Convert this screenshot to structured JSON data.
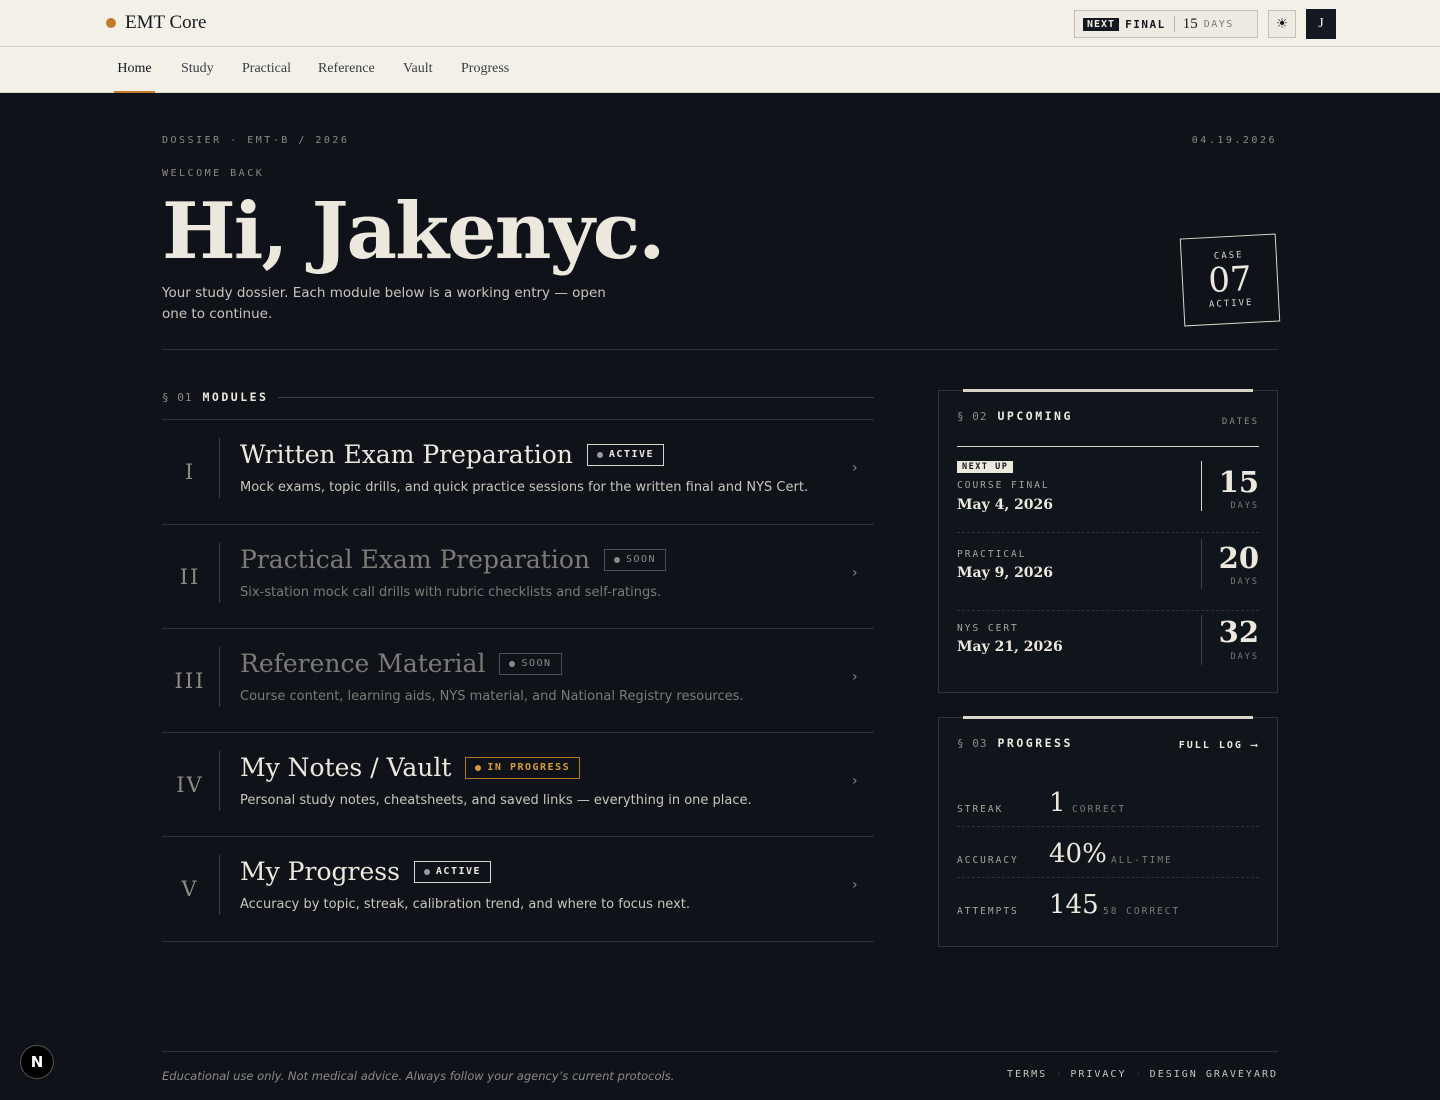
{
  "app": {
    "name": "EMT Core"
  },
  "countdown": {
    "tag": "NEXT",
    "label": "FINAL",
    "value": "15",
    "unit": "DAYS"
  },
  "user": {
    "initial": "J"
  },
  "nav": [
    "Home",
    "Study",
    "Practical",
    "Reference",
    "Vault",
    "Progress"
  ],
  "header": {
    "dossier": "DOSSIER · EMT-B / 2026",
    "date": "04.19.2026",
    "welcome": "WELCOME BACK",
    "greeting": "Hi, Jakenyc.",
    "intro": "Your study dossier. Each module below is a working entry — open one to continue.",
    "case": {
      "label": "CASE",
      "number": "07",
      "status": "ACTIVE"
    }
  },
  "modules_section": {
    "num": "§ 01",
    "title": "MODULES"
  },
  "modules": [
    {
      "roman": "I",
      "title": "Written Exam Preparation",
      "badge": "ACTIVE",
      "desc": "Mock exams, topic drills, and quick practice sessions for the written final and NYS Cert."
    },
    {
      "roman": "II",
      "title": "Practical Exam Preparation",
      "badge": "SOON",
      "desc": "Six-station mock call drills with rubric checklists and self-ratings."
    },
    {
      "roman": "III",
      "title": "Reference Material",
      "badge": "SOON",
      "desc": "Course content, learning aids, NYS material, and National Registry resources."
    },
    {
      "roman": "IV",
      "title": "My Notes / Vault",
      "badge": "IN PROGRESS",
      "desc": "Personal study notes, cheatsheets, and saved links — everything in one place."
    },
    {
      "roman": "V",
      "title": "My Progress",
      "badge": "ACTIVE",
      "desc": "Accuracy by topic, streak, calibration trend, and where to focus next."
    }
  ],
  "upcoming": {
    "num": "§ 02",
    "title": "UPCOMING",
    "right": "DATES",
    "next_up": "NEXT UP",
    "items": [
      {
        "label": "COURSE FINAL",
        "date": "May 4, 2026",
        "days": "15",
        "unit": "DAYS"
      },
      {
        "label": "PRACTICAL",
        "date": "May 9, 2026",
        "days": "20",
        "unit": "DAYS"
      },
      {
        "label": "NYS CERT",
        "date": "May 21, 2026",
        "days": "32",
        "unit": "DAYS"
      }
    ]
  },
  "progress": {
    "num": "§ 03",
    "title": "PROGRESS",
    "link": "FULL LOG",
    "stats": [
      {
        "label": "STREAK",
        "value": "1",
        "sub": "CORRECT"
      },
      {
        "label": "ACCURACY",
        "value": "40%",
        "sub": "ALL-TIME"
      },
      {
        "label": "ATTEMPTS",
        "value": "145",
        "sub": "58 CORRECT"
      }
    ]
  },
  "footer": {
    "disclaimer": "Educational use only. Not medical advice. Always follow your agency’s current protocols.",
    "links": [
      "TERMS",
      "PRIVACY",
      "DESIGN GRAVEYARD"
    ]
  },
  "dev_badge": "N"
}
